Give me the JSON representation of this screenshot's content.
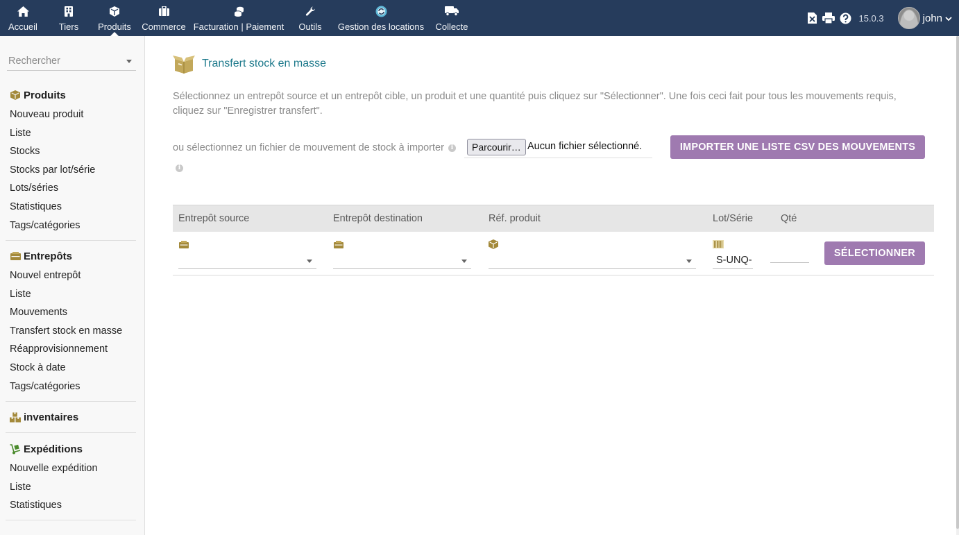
{
  "topmenu": [
    {
      "label": "Accueil",
      "icon": "home-icon"
    },
    {
      "label": "Tiers",
      "icon": "building-icon"
    },
    {
      "label": "Produits",
      "icon": "cube-icon",
      "active": true
    },
    {
      "label": "Commerce",
      "icon": "briefcase-icon"
    },
    {
      "label": "Facturation | Paiement",
      "icon": "coins-icon"
    },
    {
      "label": "Outils",
      "icon": "wrench-icon"
    },
    {
      "label": "Gestion des locations",
      "icon": "rental-icon"
    },
    {
      "label": "Collecte",
      "icon": "truck-icon"
    }
  ],
  "topright": {
    "version": "15.0.3",
    "username": "john",
    "icons": [
      "export-excel-icon",
      "print-icon",
      "help-icon"
    ]
  },
  "sidebar": {
    "search_placeholder": "Rechercher",
    "produits": {
      "title": "Produits",
      "items": [
        "Nouveau produit",
        "Liste",
        "Stocks",
        "Stocks par lot/série",
        "Lots/séries",
        "Statistiques",
        "Tags/catégories"
      ]
    },
    "entrepots": {
      "title": "Entrepôts",
      "items": [
        "Nouvel entrepôt",
        "Liste",
        "Mouvements",
        "Transfert stock en masse",
        "Réapprovisionnement",
        "Stock à date",
        "Tags/catégories"
      ]
    },
    "inventaires": {
      "title": "inventaires"
    },
    "expeditions": {
      "title": "Expéditions",
      "items": [
        "Nouvelle expédition",
        "Liste",
        "Statistiques"
      ]
    }
  },
  "main": {
    "title": "Transfert stock en masse",
    "intro": "Sélectionnez un entrepôt source et un entrepôt cible, un produit et une quantité puis cliquez sur \"Sélectionner\". Une fois ceci fait pour tous les mouvements requis, cliquez sur \"Enregistrer transfert\".",
    "import_label": "ou sélectionnez un fichier de mouvement de stock à importer",
    "file_button": "Parcourir…",
    "file_status": "Aucun fichier sélectionné.",
    "import_button": "IMPORTER UNE LISTE CSV DES MOUVEMENTS"
  },
  "table": {
    "headers": {
      "source": "Entrepôt source",
      "dest": "Entrepôt destination",
      "product": "Réf. produit",
      "lot": "Lot/Série",
      "qty": "Qté"
    },
    "row": {
      "lot_value": "S-UNQ-",
      "qty_value": "",
      "select_button": "SÉLECTIONNER"
    }
  },
  "colors": {
    "topbar": "#263c5c",
    "accent_button": "#9f7ab0",
    "title": "#1e7a8c",
    "icon_gold": "#a3893a"
  }
}
